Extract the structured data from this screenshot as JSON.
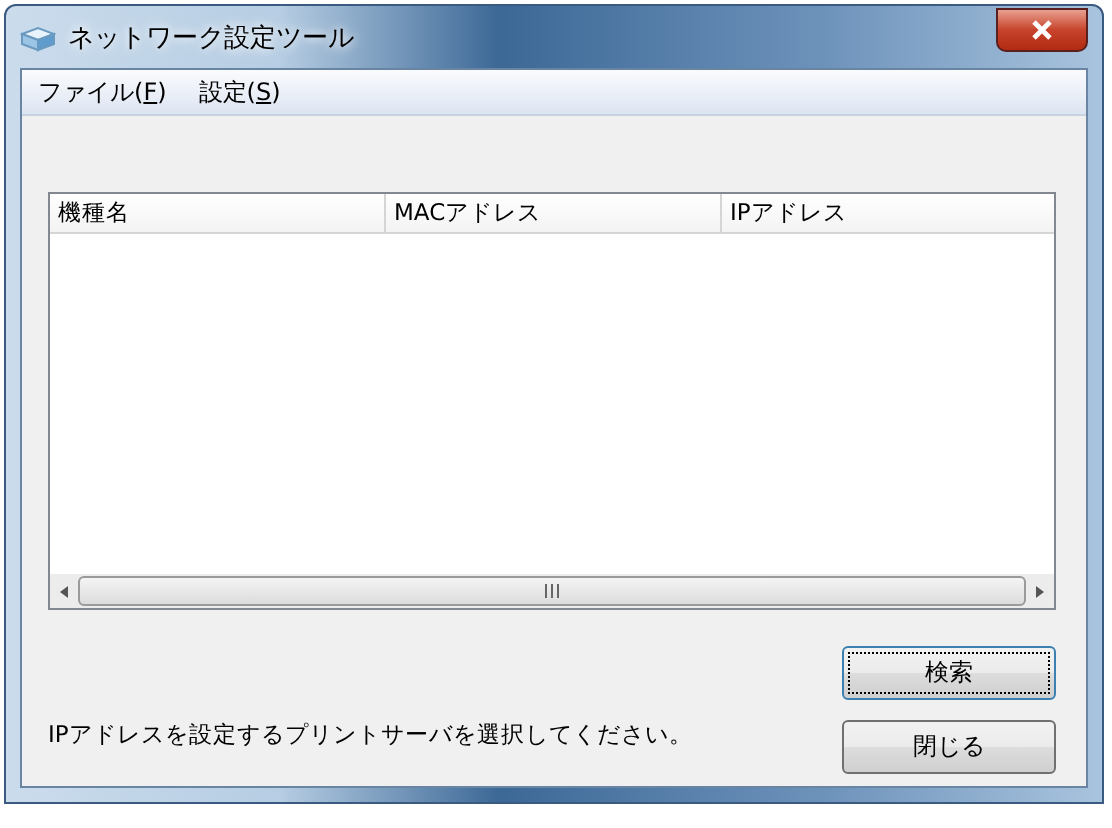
{
  "window": {
    "title": "ネットワーク設定ツール"
  },
  "menu": [
    {
      "before": "ファイル(",
      "mnemonic": "F",
      "after": ")"
    },
    {
      "before": "設定(",
      "mnemonic": "S",
      "after": ")"
    }
  ],
  "table": {
    "columns": [
      "機種名",
      "MACアドレス",
      "IPアドレス"
    ]
  },
  "message": "IPアドレスを設定するプリントサーバを選択してください。",
  "buttons": [
    {
      "label": "検索",
      "focused": true
    },
    {
      "label": "閉じる",
      "focused": false
    }
  ]
}
